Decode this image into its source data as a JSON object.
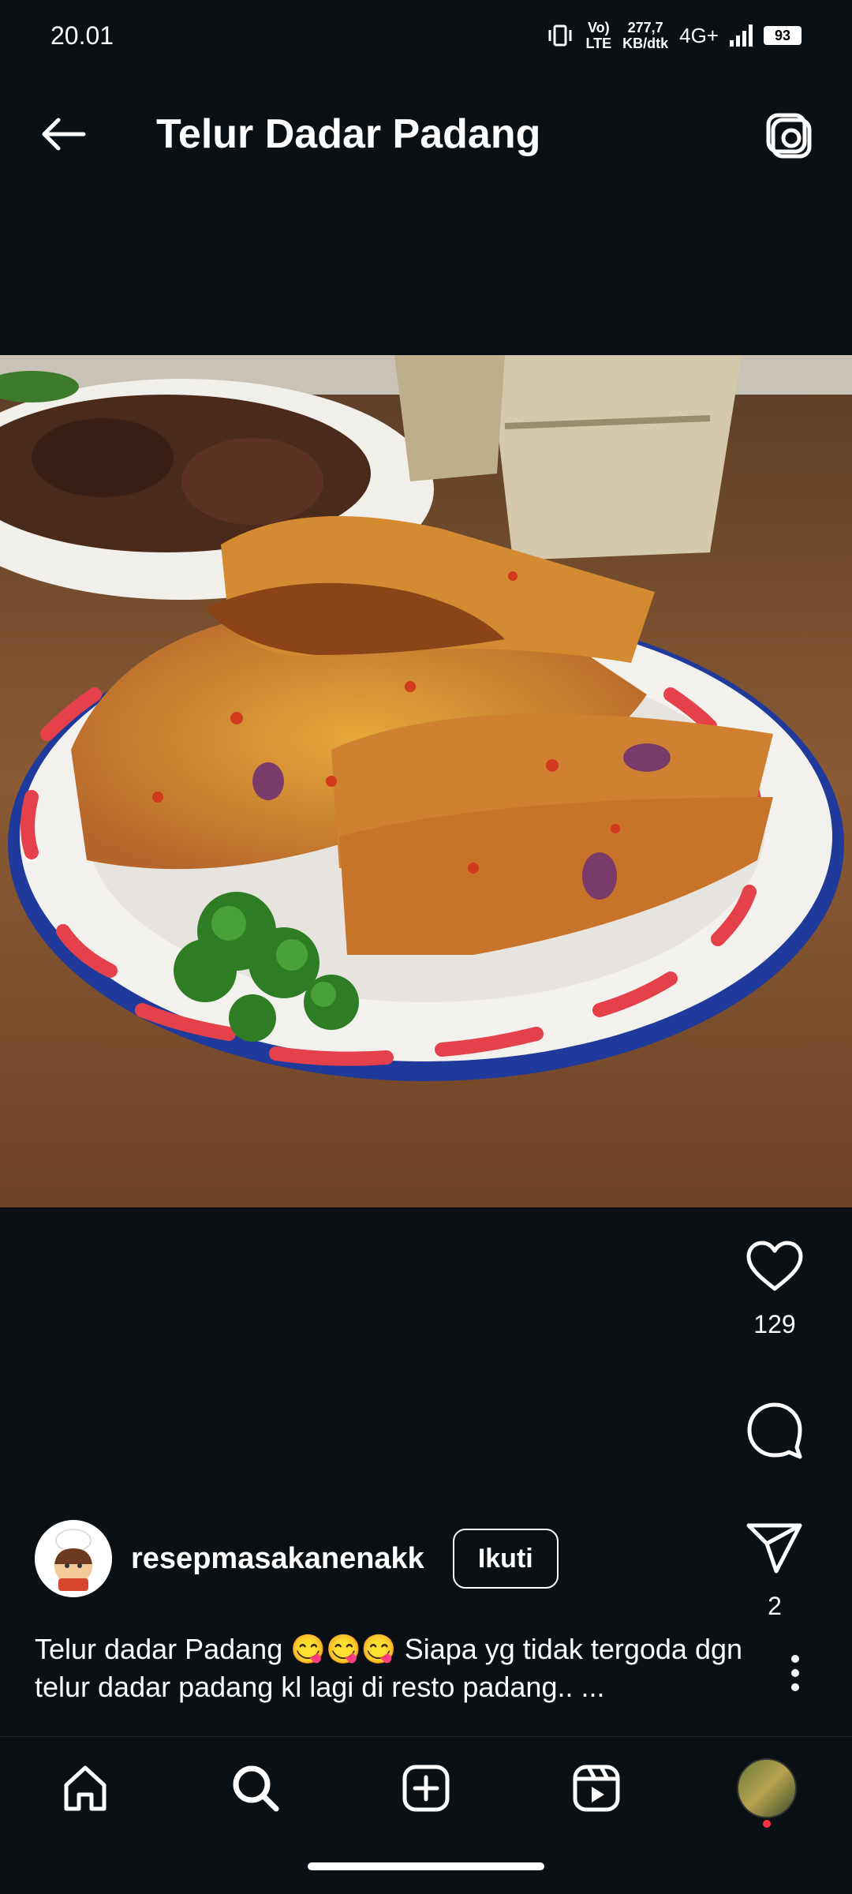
{
  "status": {
    "time": "20.01",
    "volte_top": "Vo)",
    "volte_bottom": "LTE",
    "speed_top": "277,7",
    "speed_bottom": "KB/dtk",
    "network": "4G+",
    "battery": "93"
  },
  "header": {
    "title": "Telur Dadar Padang"
  },
  "post": {
    "likes": "129",
    "shares": "2",
    "username": "resepmasakanenakk",
    "follow_label": "Ikuti",
    "caption": "Telur dadar Padang 😋😋😋 Siapa yg tidak tergoda dgn telur dadar padang kl lagi di resto padang.. ..."
  },
  "colors": {
    "background": "#0b1014",
    "notification_dot": "#ff3040"
  },
  "icons": {
    "back": "arrow-left-icon",
    "camera": "camera-icon",
    "like": "heart-icon",
    "comment": "comment-icon",
    "share": "send-icon",
    "more": "more-vertical-icon",
    "nav": [
      "home-icon",
      "search-icon",
      "create-icon",
      "reels-icon",
      "profile-avatar"
    ]
  }
}
